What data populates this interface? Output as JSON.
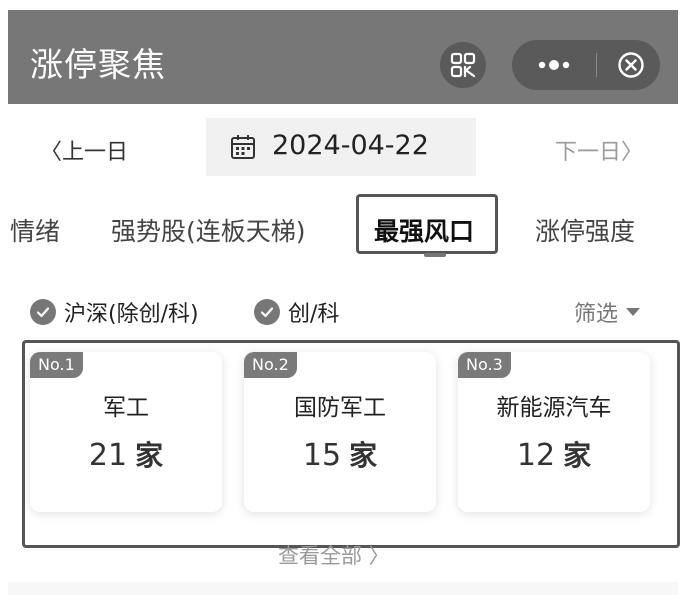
{
  "header": {
    "title": "涨停聚焦",
    "qr_icon": "qr-code-icon",
    "more_icon": "more-dots-icon",
    "close_icon": "close-circle-icon"
  },
  "date_nav": {
    "prev_label": "〈上一日",
    "date": "2024-04-22",
    "calendar_icon": "calendar-icon",
    "next_label": "下一日〉"
  },
  "tabs": [
    {
      "label": "情绪"
    },
    {
      "label": "强势股(连板天梯)"
    },
    {
      "label": "最强风口",
      "active": true
    },
    {
      "label": "涨停强度"
    }
  ],
  "filters": {
    "items": [
      {
        "label": "沪深(除创/科)",
        "checked": true
      },
      {
        "label": "创/科",
        "checked": true
      }
    ],
    "sift_label": "筛选"
  },
  "cards": [
    {
      "rank": "No.1",
      "name": "军工",
      "count": "21",
      "unit": "家"
    },
    {
      "rank": "No.2",
      "name": "国防军工",
      "count": "15",
      "unit": "家"
    },
    {
      "rank": "No.3",
      "name": "新能源汽车",
      "count": "12",
      "unit": "家"
    }
  ],
  "view_all": "查看全部 〉",
  "colors": {
    "header_bg": "#777777",
    "accent": "#555555"
  }
}
